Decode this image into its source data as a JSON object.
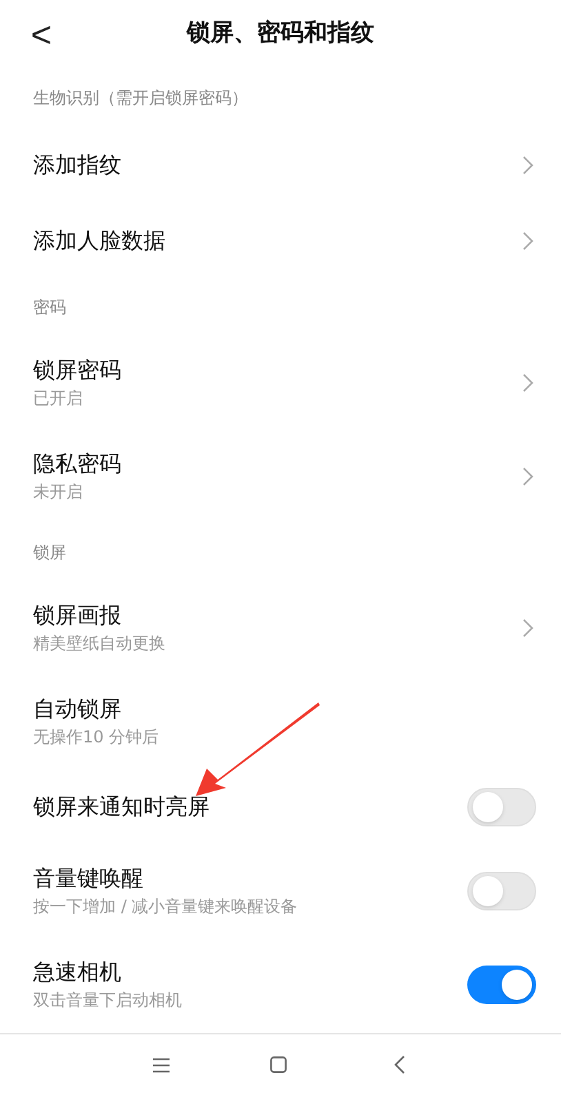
{
  "header": {
    "back": "<",
    "title": "锁屏、密码和指纹"
  },
  "sections": [
    {
      "title": "生物识别（需开启锁屏密码）",
      "items": [
        {
          "kind": "link",
          "label": "添加指纹"
        },
        {
          "kind": "link",
          "label": "添加人脸数据"
        }
      ]
    },
    {
      "title": "密码",
      "items": [
        {
          "kind": "link",
          "label": "锁屏密码",
          "subtitle": "已开启"
        },
        {
          "kind": "link",
          "label": "隐私密码",
          "subtitle": "未开启"
        }
      ]
    },
    {
      "title": "锁屏",
      "items": [
        {
          "kind": "link",
          "label": "锁屏画报",
          "subtitle": "精美壁纸自动更换"
        },
        {
          "kind": "plain",
          "label": "自动锁屏",
          "subtitle": "无操作10 分钟后"
        },
        {
          "kind": "toggle",
          "label": "锁屏来通知时亮屏",
          "on": false
        },
        {
          "kind": "toggle",
          "label": "音量键唤醒",
          "subtitle": "按一下增加 / 减小音量键来唤醒设备",
          "on": false
        },
        {
          "kind": "toggle",
          "label": "急速相机",
          "subtitle": "双击音量下启动相机",
          "on": true
        }
      ]
    }
  ]
}
